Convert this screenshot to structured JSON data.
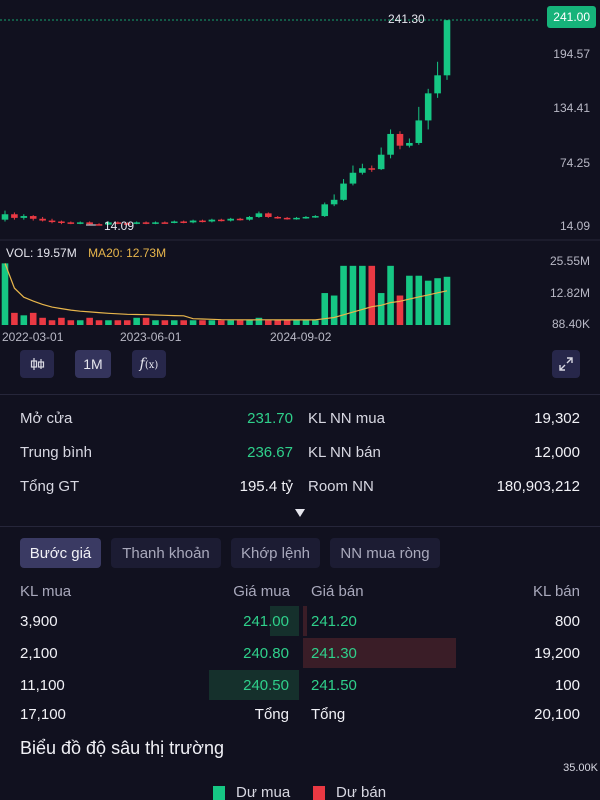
{
  "colors": {
    "up": "#16c784",
    "down": "#ea3943",
    "ma": "#e8b64c",
    "accent": "#16b37a"
  },
  "chart": {
    "price_axis": [
      "194.57",
      "134.41",
      "74.25",
      "14.09"
    ],
    "last_price": "241.00",
    "high_label": "241.30",
    "low_label": "14.09",
    "vol_label": "VOL: 19.57M",
    "ma_label": "MA20: 12.73M",
    "vol_axis": [
      "25.55M",
      "12.82M",
      "88.40K"
    ],
    "dates": [
      "2022-03-01",
      "2023-06-01",
      "2024-09-02"
    ]
  },
  "chart_data": {
    "type": "candlestick",
    "price_range": [
      14.09,
      241.3
    ],
    "candles": [
      {
        "o": 20,
        "c": 26,
        "h": 30,
        "l": 18
      },
      {
        "o": 26,
        "c": 22,
        "h": 28,
        "l": 20
      },
      {
        "o": 22,
        "c": 24,
        "h": 26,
        "l": 20
      },
      {
        "o": 24,
        "c": 21,
        "h": 25,
        "l": 19
      },
      {
        "o": 21,
        "c": 19,
        "h": 23,
        "l": 18
      },
      {
        "o": 19,
        "c": 18,
        "h": 21,
        "l": 16
      },
      {
        "o": 18,
        "c": 17,
        "h": 19,
        "l": 15
      },
      {
        "o": 17,
        "c": 16,
        "h": 18,
        "l": 15
      },
      {
        "o": 16,
        "c": 17,
        "h": 18,
        "l": 15
      },
      {
        "o": 17,
        "c": 15,
        "h": 18,
        "l": 14.5
      },
      {
        "o": 15,
        "c": 14.5,
        "h": 16,
        "l": 14.09
      },
      {
        "o": 14.5,
        "c": 17,
        "h": 18,
        "l": 14.3
      },
      {
        "o": 17,
        "c": 16,
        "h": 18,
        "l": 15
      },
      {
        "o": 16,
        "c": 15.5,
        "h": 17,
        "l": 15
      },
      {
        "o": 15.5,
        "c": 17,
        "h": 18,
        "l": 15
      },
      {
        "o": 17,
        "c": 16,
        "h": 18,
        "l": 15
      },
      {
        "o": 16,
        "c": 17,
        "h": 18,
        "l": 15
      },
      {
        "o": 17,
        "c": 16.5,
        "h": 18,
        "l": 16
      },
      {
        "o": 16.5,
        "c": 18,
        "h": 19,
        "l": 16
      },
      {
        "o": 18,
        "c": 17,
        "h": 19,
        "l": 16
      },
      {
        "o": 17,
        "c": 19,
        "h": 20,
        "l": 16
      },
      {
        "o": 19,
        "c": 18,
        "h": 20,
        "l": 17
      },
      {
        "o": 18,
        "c": 20,
        "h": 21,
        "l": 17
      },
      {
        "o": 20,
        "c": 19,
        "h": 21,
        "l": 18
      },
      {
        "o": 19,
        "c": 21,
        "h": 22,
        "l": 18
      },
      {
        "o": 21,
        "c": 20,
        "h": 22,
        "l": 19
      },
      {
        "o": 20,
        "c": 23,
        "h": 24,
        "l": 19
      },
      {
        "o": 23,
        "c": 27,
        "h": 29,
        "l": 22
      },
      {
        "o": 27,
        "c": 23,
        "h": 28,
        "l": 22
      },
      {
        "o": 23,
        "c": 22,
        "h": 24,
        "l": 21
      },
      {
        "o": 22,
        "c": 21,
        "h": 23,
        "l": 20
      },
      {
        "o": 21,
        "c": 22,
        "h": 23,
        "l": 20
      },
      {
        "o": 22,
        "c": 23,
        "h": 24,
        "l": 21
      },
      {
        "o": 23,
        "c": 24,
        "h": 25,
        "l": 22
      },
      {
        "o": 24,
        "c": 37,
        "h": 39,
        "l": 23
      },
      {
        "o": 37,
        "c": 42,
        "h": 48,
        "l": 35
      },
      {
        "o": 42,
        "c": 60,
        "h": 65,
        "l": 41
      },
      {
        "o": 60,
        "c": 72,
        "h": 80,
        "l": 58
      },
      {
        "o": 72,
        "c": 77,
        "h": 82,
        "l": 70
      },
      {
        "o": 77,
        "c": 76,
        "h": 80,
        "l": 73
      },
      {
        "o": 76,
        "c": 92,
        "h": 100,
        "l": 75
      },
      {
        "o": 92,
        "c": 115,
        "h": 120,
        "l": 88
      },
      {
        "o": 115,
        "c": 102,
        "h": 118,
        "l": 98
      },
      {
        "o": 102,
        "c": 105,
        "h": 110,
        "l": 100
      },
      {
        "o": 105,
        "c": 130,
        "h": 145,
        "l": 103
      },
      {
        "o": 130,
        "c": 160,
        "h": 165,
        "l": 120
      },
      {
        "o": 160,
        "c": 180,
        "h": 195,
        "l": 155
      },
      {
        "o": 180,
        "c": 241,
        "h": 241.3,
        "l": 175
      }
    ],
    "volume": [
      25,
      5,
      4,
      5,
      3,
      2,
      3,
      2,
      2,
      3,
      2,
      2,
      2,
      2,
      3,
      3,
      2,
      2,
      2,
      2,
      2,
      2,
      2,
      2,
      2,
      2,
      2,
      3,
      2,
      2,
      2,
      2,
      2,
      2,
      13,
      12,
      24,
      24,
      24,
      24,
      13,
      24,
      12,
      20,
      20,
      18,
      19,
      19.57
    ],
    "volume_range": [
      0.0884,
      25.55
    ],
    "ma20_label": "MA20: 12.73M"
  },
  "controls": {
    "interval": "1M"
  },
  "stats": {
    "open_label": "Mở cửa",
    "open_value": "231.70",
    "avg_label": "Trung bình",
    "avg_value": "236.67",
    "total_label": "Tổng GT",
    "total_value": "195.4 tỷ",
    "nn_buy_label": "KL NN mua",
    "nn_buy_value": "19,302",
    "nn_sell_label": "KL NN bán",
    "nn_sell_value": "12,000",
    "room_label": "Room NN",
    "room_value": "180,903,212"
  },
  "tabs": [
    "Bước giá",
    "Thanh khoản",
    "Khớp lệnh",
    "NN mua ròng"
  ],
  "orderbook": {
    "headers": {
      "buy_vol": "KL mua",
      "buy_price": "Giá mua",
      "sell_price": "Giá bán",
      "sell_vol": "KL bán"
    },
    "rows": [
      {
        "buy_vol": "3,900",
        "buy_price": "241.00",
        "sell_price": "241.20",
        "sell_vol": "800"
      },
      {
        "buy_vol": "2,100",
        "buy_price": "240.80",
        "sell_price": "241.30",
        "sell_vol": "19,200"
      },
      {
        "buy_vol": "11,100",
        "buy_price": "240.50",
        "sell_price": "241.50",
        "sell_vol": "100"
      }
    ],
    "totals": {
      "buy_vol": "17,100",
      "buy_label": "Tổng",
      "sell_label": "Tổng",
      "sell_vol": "20,100"
    }
  },
  "depth": {
    "title": "Biểu đồ độ sâu thị trường",
    "axis_top": "35.00K",
    "legend_buy": "Dư mua",
    "legend_sell": "Dư bán"
  }
}
